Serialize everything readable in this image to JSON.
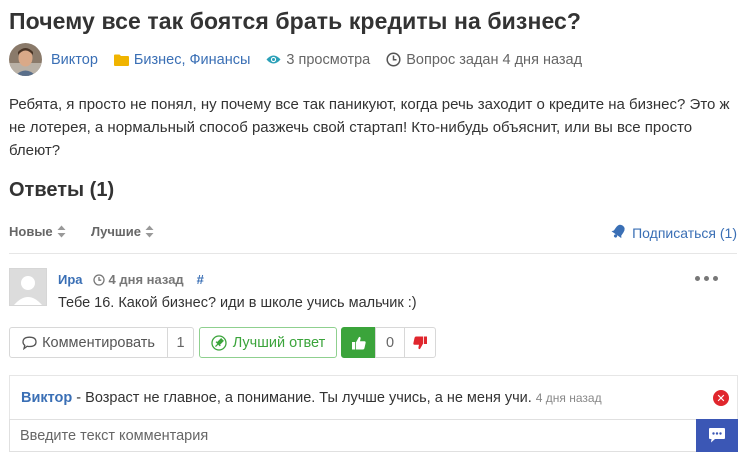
{
  "question": {
    "title": "Почему все так боятся брать кредиты на бизнес?",
    "author": "Виктор",
    "category": "Бизнес, Финансы",
    "views": "3 просмотра",
    "asked": "Вопрос задан 4 дня назад",
    "body": "Ребята, я просто не понял, ну почему все так паникуют, когда речь заходит о кредите на бизнес? Это ж не лотерея, а нормальный способ разжечь свой стартап! Кто-нибудь объяснит, или вы все просто блеют?"
  },
  "answers_header": "Ответы (1)",
  "sort": {
    "new_label": "Новые",
    "best_label": "Лучшие",
    "subscribe_label": "Подписаться (1)"
  },
  "answer": {
    "author": "Ира",
    "date": "4 дня назад",
    "hash": "#",
    "text": "Тебе 16. Какой бизнес? иди в школе учись мальчик :)",
    "comment_label": "Комментировать",
    "comment_count": "1",
    "best_answer_label": "Лучший ответ",
    "votes": "0"
  },
  "comment": {
    "author": "Виктор",
    "separator": " - ",
    "text": "Возраст не главное, а понимание. Ты лучше учись, а не меня учи.",
    "date": "4 дня назад"
  },
  "comment_input": {
    "placeholder": "Введите текст комментария",
    "value": ""
  },
  "icons": {
    "folder": "folder-icon",
    "views": "eye-icon",
    "clock": "clock-icon",
    "subscribe": "bell-icon",
    "comment": "speech-bubble-icon",
    "best": "pin-icon",
    "like": "thumbs-up-icon",
    "dislike": "thumbs-down-icon",
    "more": "more-dots-icon",
    "delete": "close-icon",
    "send": "chat-send-icon"
  },
  "colors": {
    "link": "#3a6fb5",
    "best_green": "#3ba43b",
    "dislike_red": "#e0262d",
    "send_blue": "#3b57b5",
    "folder_yellow": "#f0b400"
  }
}
